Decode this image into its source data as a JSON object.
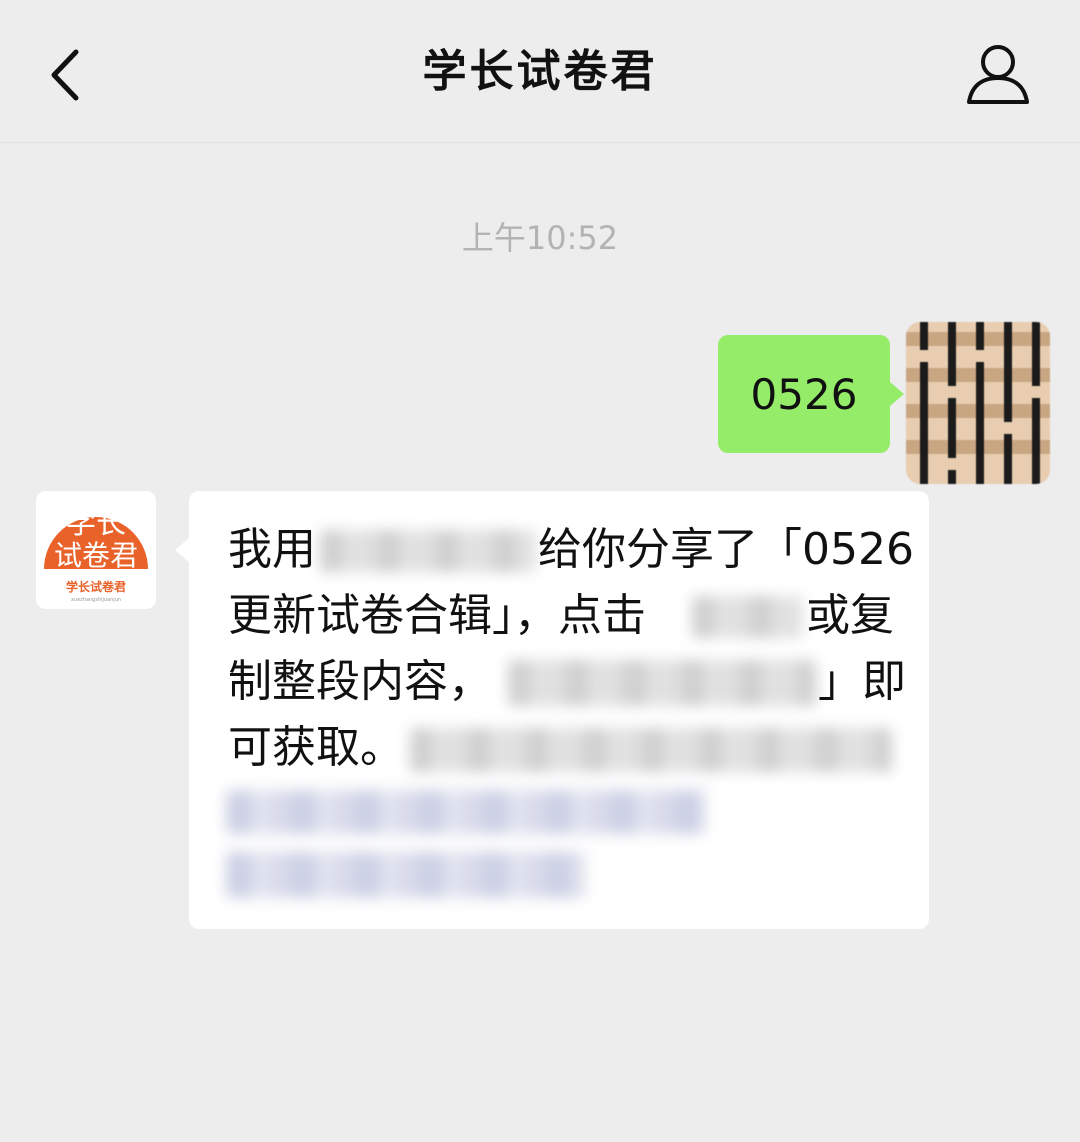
{
  "header": {
    "title": "学长试卷君",
    "back_icon": "chevron-left-icon",
    "profile_icon": "person-icon"
  },
  "chat": {
    "timestamp": "上午10:52",
    "sent_message": "0526",
    "bot_avatar": {
      "line1": "学长",
      "line2": "试卷君",
      "caption": "学长试卷君",
      "subcaption": "xuezhangshijuanjun",
      "color": "#e8622a"
    },
    "received_message": {
      "line1_start": "我用",
      "line1_end": "给你分享了「0526",
      "line2_start": "更新试卷合辑」，点击",
      "line2_end": "或复",
      "line3_start": "制整段内容，",
      "line3_end": "」即",
      "line4_start": "可获取。"
    }
  },
  "colors": {
    "background": "#ededed",
    "sent_bubble": "#95ec69",
    "received_bubble": "#ffffff",
    "timestamp": "#b3b3b3"
  }
}
